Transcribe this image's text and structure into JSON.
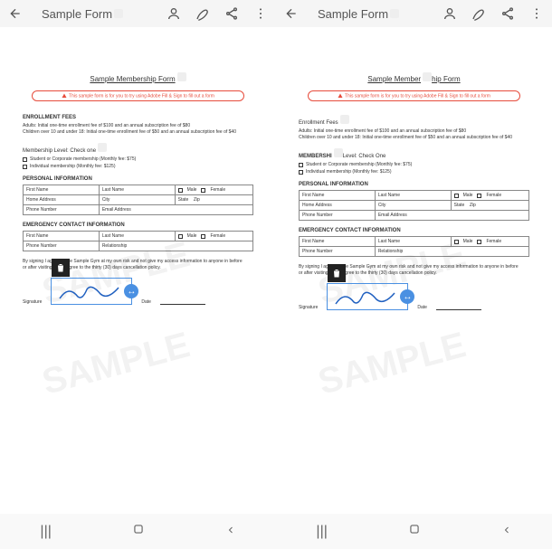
{
  "toolbar": {
    "title": "Sample Form",
    "back_icon": "back-arrow",
    "user_icon": "person",
    "edit_icon": "pen",
    "share_icon": "share",
    "more_icon": "more-vert"
  },
  "doc": {
    "title_left": "Sample Membership Form",
    "title_right_a": "Sample Member",
    "title_right_b": "hip Form",
    "banner": "This sample form is for you to try using Adobe Fill & Sign to fill out a form",
    "fees_h_left": "ENROLLMENT FEES",
    "fees_h_right_a": "Enrollment Fees",
    "fees_line1": "Adults: Initial one-time enrollment fee of $100 and an annual subscription fee of $80",
    "fees_line2": "Children over 10 and under 18: Initial one-time enrollment fee of $50 and an annual subscription fee of $40",
    "level_h_left": "Membership Level: Check one",
    "level_h_right_pre": "MEMBERSHI",
    "level_h_right_post": "Level: Check One",
    "opt1": "Student or Corporate membership (Monthly fee: $75)",
    "opt2": "Individual membership (Monthly fee: $125)",
    "personal_h": "PERSONAL INFORMATION",
    "fn": "First Name",
    "ln": "Last Name",
    "male": "Male",
    "female": "Female",
    "addr": "Home Address",
    "city": "City",
    "state": "State",
    "zip": "Zip",
    "phone": "Phone Number",
    "email": "Email Address",
    "emerg_h": "EMERGENCY CONTACT INFORMATION",
    "rel": "Relationship",
    "disclaimer1": "By signing I agree to use Sample Gym at my own risk and not give my access information to anyone in before",
    "disclaimer2": "or after visiting. I also agree to the thirty (30) days cancellation policy.",
    "sig": "Signature",
    "date": "Date",
    "watermark": "SAMPLE"
  },
  "nav": {
    "recent": "|||",
    "home": "○",
    "back": "<"
  }
}
